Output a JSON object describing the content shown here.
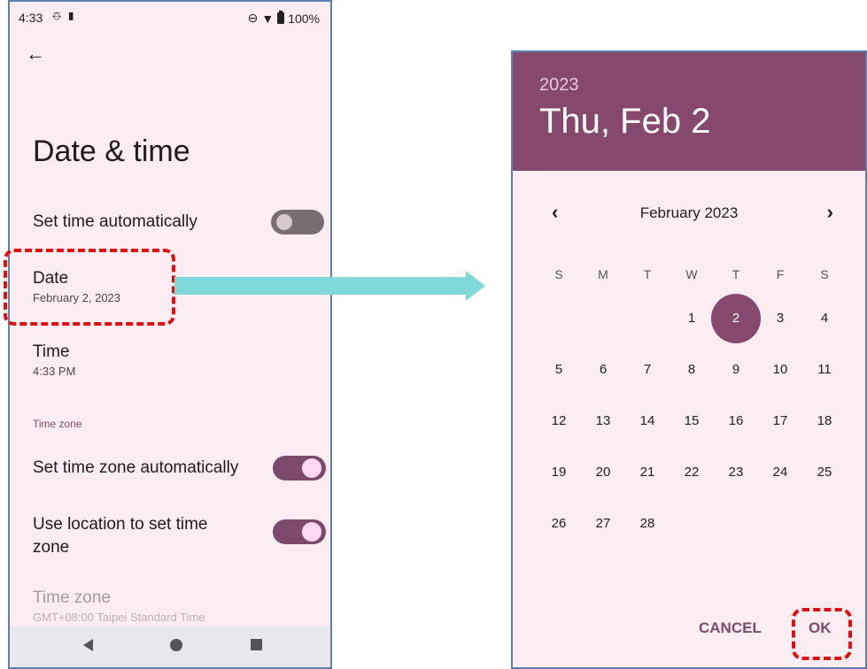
{
  "status_bar": {
    "time": "4:33",
    "left_icons": [
      "sim-icon",
      "battery-saver-icon"
    ],
    "right_icons": [
      "dnd-icon",
      "wifi-icon",
      "battery-icon"
    ],
    "battery": "100%"
  },
  "settings": {
    "title": "Date & time",
    "set_time_auto": {
      "label": "Set time automatically",
      "enabled": false
    },
    "date": {
      "label": "Date",
      "value": "February 2, 2023"
    },
    "time": {
      "label": "Time",
      "value": "4:33 PM"
    },
    "timezone_section": "Time zone",
    "set_tz_auto": {
      "label": "Set time zone automatically",
      "enabled": true
    },
    "use_location": {
      "label": "Use location to set time zone",
      "enabled": true
    },
    "time_zone": {
      "label": "Time zone",
      "value": "GMT+08:00 Taipei Standard Time"
    }
  },
  "nav_bar": {
    "icons": [
      "back-icon",
      "home-icon",
      "recents-icon"
    ]
  },
  "dialog": {
    "year": "2023",
    "date": "Thu, Feb 2",
    "month_label": "February 2023",
    "weekdays": [
      "S",
      "M",
      "T",
      "W",
      "T",
      "F",
      "S"
    ],
    "weeks": [
      [
        "",
        "",
        "",
        "1",
        "2",
        "3",
        "4"
      ],
      [
        "5",
        "6",
        "7",
        "8",
        "9",
        "10",
        "11"
      ],
      [
        "12",
        "13",
        "14",
        "15",
        "16",
        "17",
        "18"
      ],
      [
        "19",
        "20",
        "21",
        "22",
        "23",
        "24",
        "25"
      ],
      [
        "26",
        "27",
        "28",
        "",
        "",
        "",
        ""
      ]
    ],
    "selected_day": "2",
    "cancel": "CANCEL",
    "ok": "OK"
  },
  "colors": {
    "accent": "#87486d",
    "highlight": "#e01010",
    "arrow": "#80d9d8",
    "background": "#fcedf3"
  }
}
